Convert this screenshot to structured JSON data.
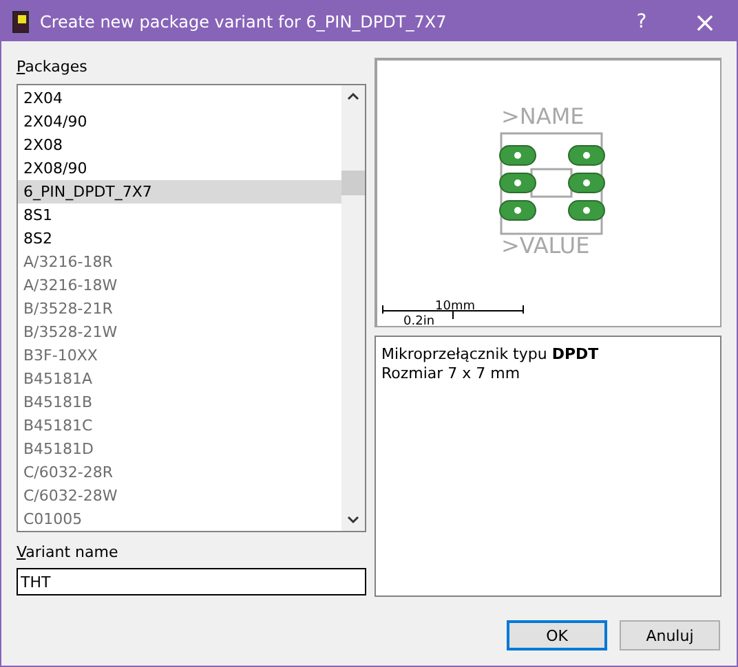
{
  "window": {
    "title": "Create new package variant for 6_PIN_DPDT_7X7",
    "help": "?",
    "close": "×"
  },
  "packages": {
    "label": "Packages",
    "items": [
      {
        "name": "2X04",
        "selected": false,
        "disabled": false
      },
      {
        "name": "2X04/90",
        "selected": false,
        "disabled": false
      },
      {
        "name": "2X08",
        "selected": false,
        "disabled": false
      },
      {
        "name": "2X08/90",
        "selected": false,
        "disabled": false
      },
      {
        "name": "6_PIN_DPDT_7X7",
        "selected": true,
        "disabled": false
      },
      {
        "name": "8S1",
        "selected": false,
        "disabled": false
      },
      {
        "name": "8S2",
        "selected": false,
        "disabled": false
      },
      {
        "name": "A/3216-18R",
        "selected": false,
        "disabled": true
      },
      {
        "name": "A/3216-18W",
        "selected": false,
        "disabled": true
      },
      {
        "name": "B/3528-21R",
        "selected": false,
        "disabled": true
      },
      {
        "name": "B/3528-21W",
        "selected": false,
        "disabled": true
      },
      {
        "name": "B3F-10XX",
        "selected": false,
        "disabled": true
      },
      {
        "name": "B45181A",
        "selected": false,
        "disabled": true
      },
      {
        "name": "B45181B",
        "selected": false,
        "disabled": true
      },
      {
        "name": "B45181C",
        "selected": false,
        "disabled": true
      },
      {
        "name": "B45181D",
        "selected": false,
        "disabled": true
      },
      {
        "name": "C/6032-28R",
        "selected": false,
        "disabled": true
      },
      {
        "name": "C/6032-28W",
        "selected": false,
        "disabled": true
      },
      {
        "name": "C01005",
        "selected": false,
        "disabled": true
      }
    ]
  },
  "variant": {
    "label": "Variant name",
    "value": "THT"
  },
  "preview": {
    "name_text": ">NAME",
    "value_text": ">VALUE",
    "scale_mm": "10mm",
    "scale_in": "0.2in"
  },
  "description": [
    "Mikroprzełącznik typu **DPDT**",
    "Rozmiar 7 x 7 mm"
  ],
  "buttons": [
    {
      "label": "OK",
      "default": true
    },
    {
      "label": "Anuluj",
      "default": false
    }
  ]
}
